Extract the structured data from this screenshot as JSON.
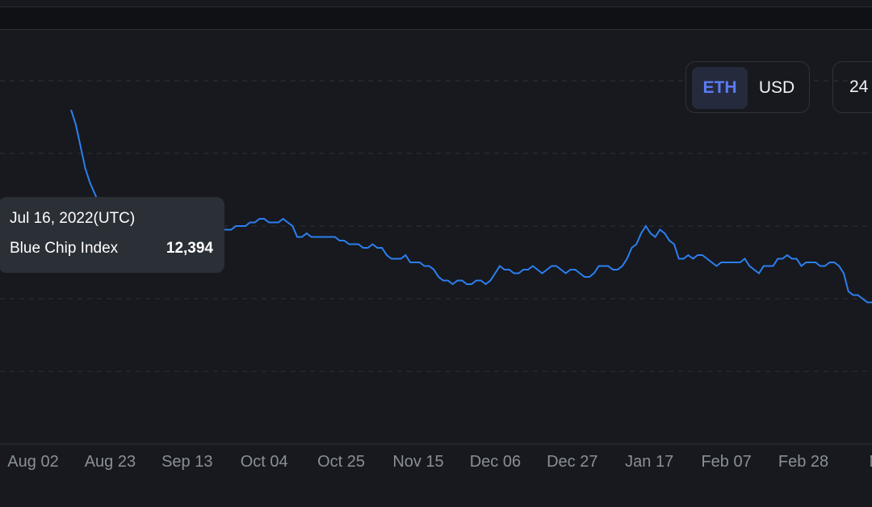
{
  "currency_toggle": {
    "options": [
      "ETH",
      "USD"
    ],
    "selected": "ETH"
  },
  "time_range": {
    "label": "24"
  },
  "tooltip": {
    "date": "Jul 16, 2022(UTC)",
    "series_name": "Blue Chip Index",
    "value": "12,394"
  },
  "chart_data": {
    "type": "line",
    "title": "",
    "xlabel": "",
    "ylabel": "",
    "grid": true,
    "x_tick_labels": [
      "Aug 02",
      "Aug 23",
      "Sep 13",
      "Oct 04",
      "Oct 25",
      "Nov 15",
      "Dec 06",
      "Dec 27",
      "Jan 17",
      "Feb 07",
      "Feb 28",
      "Ma"
    ],
    "ylim": [
      0,
      100
    ],
    "series": [
      {
        "name": "Blue Chip Index",
        "color": "#2b7ff0",
        "values": [
          92,
          88,
          82,
          76,
          72,
          69,
          66,
          64,
          63,
          62,
          58,
          59,
          59,
          60,
          61,
          61,
          63,
          63,
          62,
          62,
          61,
          62,
          62,
          61,
          61,
          60,
          59,
          60,
          59,
          60,
          61,
          60,
          59,
          59,
          59,
          60,
          60,
          60,
          61,
          61,
          62,
          62,
          61,
          61,
          61,
          62,
          61,
          60,
          57,
          57,
          58,
          57,
          57,
          57,
          57,
          57,
          57,
          56,
          56,
          55,
          55,
          55,
          54,
          54,
          55,
          54,
          54,
          52,
          51,
          51,
          51,
          52,
          50,
          50,
          50,
          49,
          49,
          48,
          46,
          45,
          45,
          44,
          45,
          45,
          44,
          44,
          45,
          45,
          44,
          45,
          47,
          49,
          48,
          48,
          47,
          47,
          48,
          48,
          49,
          48,
          47,
          48,
          49,
          49,
          48,
          47,
          48,
          48,
          47,
          46,
          46,
          47,
          49,
          49,
          49,
          48,
          48,
          49,
          51,
          54,
          55,
          58,
          60,
          58,
          57,
          59,
          58,
          56,
          55,
          51,
          51,
          52,
          51,
          52,
          52,
          51,
          50,
          49,
          50,
          50,
          50,
          50,
          50,
          51,
          49,
          48,
          47,
          49,
          49,
          49,
          51,
          51,
          52,
          51,
          51,
          49,
          50,
          50,
          50,
          49,
          49,
          50,
          50,
          49,
          47,
          42,
          41,
          41,
          40,
          39,
          39
        ]
      }
    ]
  }
}
